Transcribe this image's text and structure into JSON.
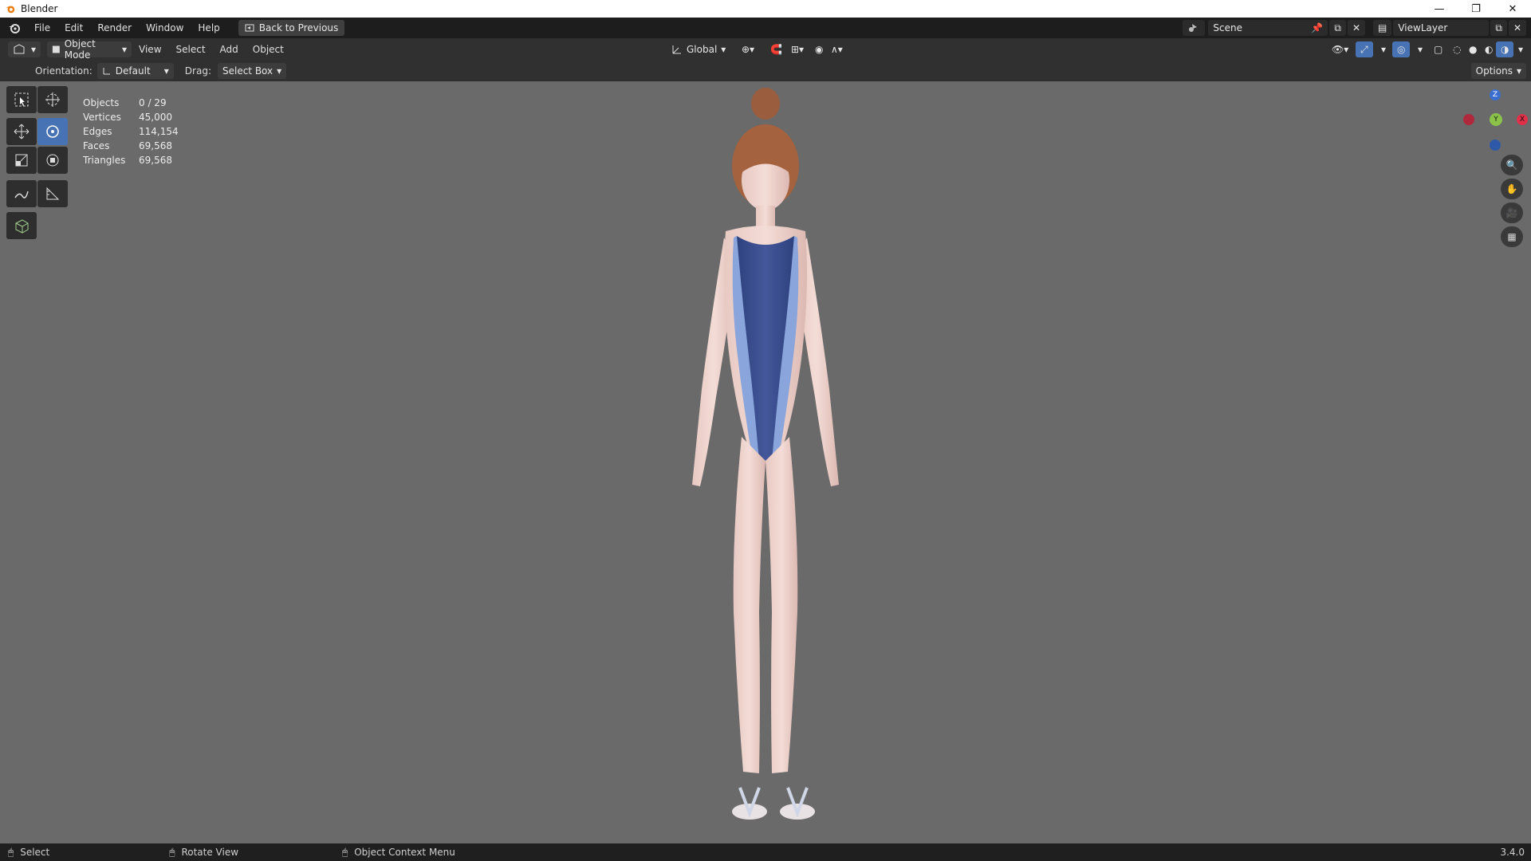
{
  "window": {
    "title": "Blender",
    "controls": [
      "—",
      "❐",
      "✕"
    ]
  },
  "menubar": {
    "items": [
      "File",
      "Edit",
      "Render",
      "Window",
      "Help"
    ],
    "back_button": "Back to Previous",
    "scene": "Scene",
    "view_layer": "ViewLayer"
  },
  "header": {
    "mode": "Object Mode",
    "menus": [
      "View",
      "Select",
      "Add",
      "Object"
    ],
    "transform": "Global"
  },
  "tool_settings": {
    "orientation_label": "Orientation:",
    "orientation_value": "Default",
    "drag_label": "Drag:",
    "drag_value": "Select Box",
    "options": "Options"
  },
  "stats": [
    {
      "label": "Objects",
      "value": "0 / 29"
    },
    {
      "label": "Vertices",
      "value": "45,000"
    },
    {
      "label": "Edges",
      "value": "114,154"
    },
    {
      "label": "Faces",
      "value": "69,568"
    },
    {
      "label": "Triangles",
      "value": "69,568"
    }
  ],
  "gizmo": {
    "z": "Z",
    "y": "Y",
    "x": "X"
  },
  "statusbar": {
    "left": "Select",
    "middle": "Rotate View",
    "right": "Object Context Menu",
    "version": "3.4.0"
  },
  "colors": {
    "accent": "#4772b3",
    "x_axis": "#e0304a",
    "y_axis": "#8bc34a",
    "z_axis": "#3a6fd0"
  }
}
